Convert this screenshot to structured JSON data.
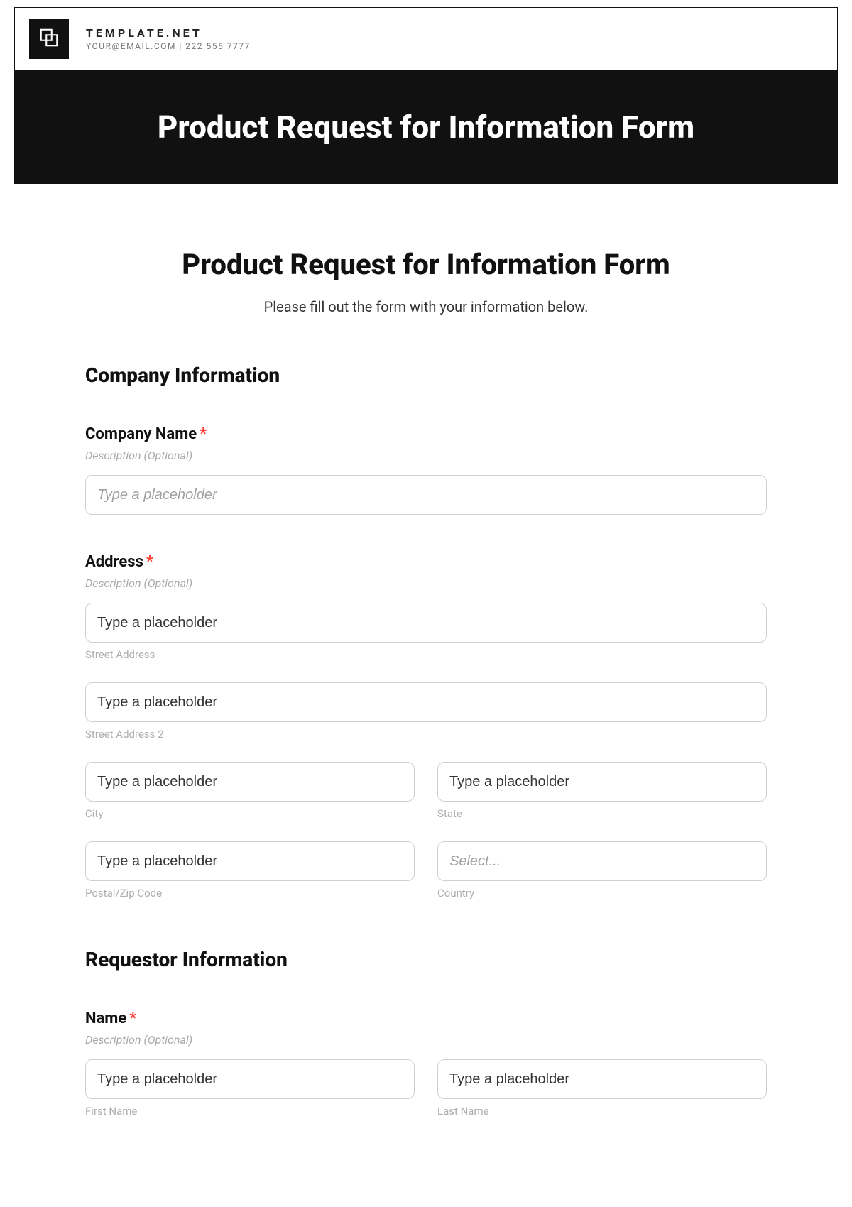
{
  "brand": {
    "name": "TEMPLATE.NET",
    "sub": "YOUR@EMAIL.COM | 222 555 7777"
  },
  "banner_title": "Product Request for Information Form",
  "content": {
    "title": "Product Request for Information Form",
    "subtitle": "Please fill out the form with your information below."
  },
  "sections": {
    "company": {
      "heading": "Company Information",
      "company_name": {
        "label": "Company Name",
        "required_mark": "*",
        "description": "Description (Optional)",
        "placeholder": "Type a placeholder"
      },
      "address": {
        "label": "Address",
        "required_mark": "*",
        "description": "Description (Optional)",
        "street1": {
          "placeholder": "Type a placeholder",
          "sub": "Street Address"
        },
        "street2": {
          "placeholder": "Type a placeholder",
          "sub": "Street Address 2"
        },
        "city": {
          "placeholder": "Type a placeholder",
          "sub": "City"
        },
        "state": {
          "placeholder": "Type a placeholder",
          "sub": "State"
        },
        "postal": {
          "placeholder": "Type a placeholder",
          "sub": "Postal/Zip Code"
        },
        "country": {
          "placeholder": "Select...",
          "sub": "Country"
        }
      }
    },
    "requestor": {
      "heading": "Requestor Information",
      "name": {
        "label": "Name",
        "required_mark": "*",
        "description": "Description (Optional)",
        "first": {
          "placeholder": "Type a placeholder",
          "sub": "First Name"
        },
        "last": {
          "placeholder": "Type a placeholder",
          "sub": "Last Name"
        }
      }
    }
  }
}
